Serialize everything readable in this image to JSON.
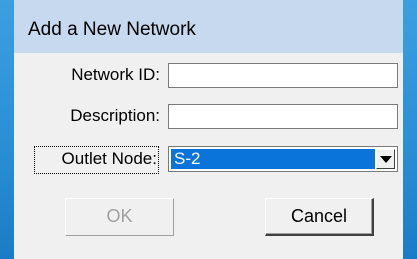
{
  "dialog": {
    "title": "Add a New Network"
  },
  "form": {
    "network_id_label": "Network ID:",
    "network_id_value": "",
    "description_label": "Description:",
    "description_value": "",
    "outlet_node_label": "Outlet Node:",
    "outlet_node_value": "S-2"
  },
  "buttons": {
    "ok_label": "OK",
    "ok_enabled": false,
    "cancel_label": "Cancel"
  },
  "icons": {
    "dropdown": "chevron-down-icon"
  },
  "colors": {
    "titlebar_bg": "#c6d9ee",
    "selection_bg": "#0a74da",
    "desktop_bg": "#2b8fd6"
  }
}
